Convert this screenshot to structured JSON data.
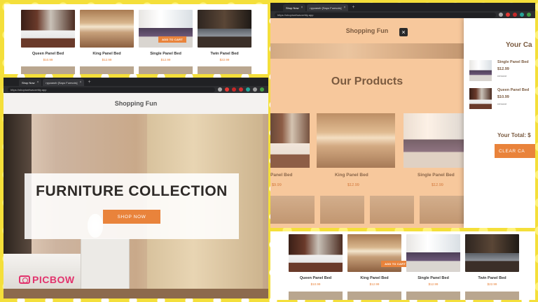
{
  "products": [
    {
      "name": "Queen Panel Bed",
      "price": "$10.99"
    },
    {
      "name": "King Panel Bed",
      "price": "$12.99"
    },
    {
      "name": "Single Panel Bed",
      "price": "$12.99"
    },
    {
      "name": "Twin Panel Bed",
      "price": "$22.99"
    }
  ],
  "add_to_cart_label": "ADD TO CART",
  "browser": {
    "tabs": [
      {
        "title": "Shop Now"
      },
      {
        "title": "rpyzawrb [Sapo Fumvols]"
      }
    ],
    "url": "https://shoptunfwavzefdy.app"
  },
  "site": {
    "title": "Shopping Fun",
    "hero_title": "FURNITURE COLLECTION",
    "hero_button": "SHOP NOW",
    "products_heading": "Our Products"
  },
  "main_grid": [
    {
      "name": "Panel Bed",
      "price": "$9.99"
    },
    {
      "name": "King Panel Bed",
      "price": "$12.99"
    },
    {
      "name": "Single Panel Bed",
      "price": "$12.99"
    }
  ],
  "cart": {
    "title": "Your Ca",
    "items": [
      {
        "name": "Single Panel Bed",
        "price": "$12.99",
        "remove": "remove"
      },
      {
        "name": "Queen Panel Bed",
        "price": "$10.99",
        "remove": "remove"
      }
    ],
    "total": "Your Total: $",
    "clear_button": "CLEAR CA"
  },
  "watermark": "PICBOW",
  "colors": {
    "accent": "#e9833b",
    "text_brown": "#7a5a3f",
    "overlay_tint": "#f7c89c",
    "watermark": "#e2336d"
  }
}
